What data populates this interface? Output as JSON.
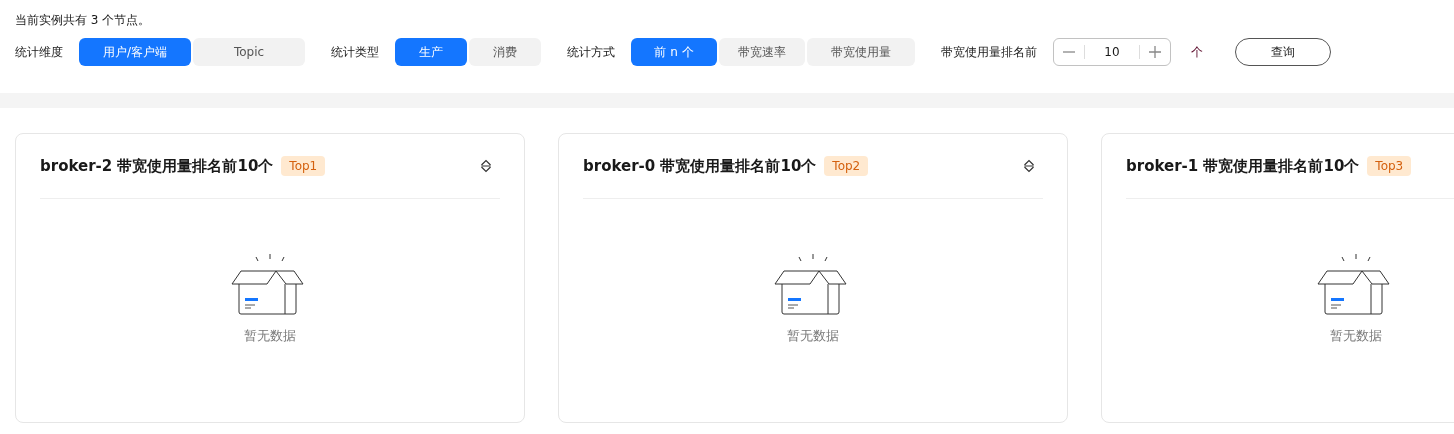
{
  "summary": "当前实例共有 3 个节点。",
  "filters": [
    {
      "label": "统计维度",
      "options": [
        {
          "label": "用户/客户端",
          "selected": true
        },
        {
          "label": "Topic",
          "selected": false
        }
      ]
    },
    {
      "label": "统计类型",
      "options": [
        {
          "label": "生产",
          "selected": true
        },
        {
          "label": "消费",
          "selected": false
        }
      ]
    },
    {
      "label": "统计方式",
      "options": [
        {
          "label": "前 n 个",
          "selected": true
        },
        {
          "label": "带宽速率",
          "selected": false
        },
        {
          "label": "带宽使用量",
          "selected": false
        }
      ]
    }
  ],
  "rank": {
    "label": "带宽使用量排名前",
    "value": "10",
    "unit": "个"
  },
  "query_button": "查询",
  "cards": [
    {
      "title": "broker-2 带宽使用量排名前10个",
      "badge": "Top1",
      "empty_text": "暂无数据"
    },
    {
      "title": "broker-0 带宽使用量排名前10个",
      "badge": "Top2",
      "empty_text": "暂无数据"
    },
    {
      "title": "broker-1 带宽使用量排名前10个",
      "badge": "Top3",
      "empty_text": "暂无数据"
    }
  ]
}
